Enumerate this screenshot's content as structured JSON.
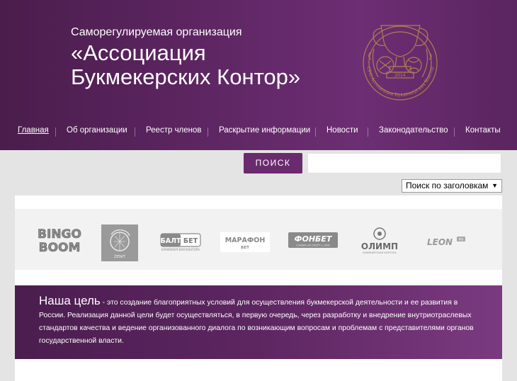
{
  "header": {
    "subtitle": "Саморегулируемая организация",
    "title": "«Ассоциация Букмекерских Контор»",
    "emblem_year": "2014",
    "emblem_ring_text": "СРО Ассоциация Букмекерских Контор"
  },
  "nav": {
    "items": [
      {
        "label": "Главная"
      },
      {
        "label": "Об организации"
      },
      {
        "label": "Реестр членов"
      },
      {
        "label": "Раскрытие информации"
      },
      {
        "label": "Новости"
      },
      {
        "label": "Законодательство"
      },
      {
        "label": "Контакты"
      }
    ]
  },
  "search": {
    "button_label": "ПОИСК",
    "placeholder": "",
    "mode_select": "Поиск по заголовкам"
  },
  "partners": [
    {
      "name": "BINGO BOOM"
    },
    {
      "name": "ZENIT"
    },
    {
      "name": "БАЛТБЕТ"
    },
    {
      "name": "МАРАФОН БЕТ"
    },
    {
      "name": "ФОНБЕТ"
    },
    {
      "name": "ОЛИМП"
    },
    {
      "name": "LEON"
    }
  ],
  "goal": {
    "heading": "Наша цель",
    "text": " - это создание благоприятных условий для осуществления букмекерской деятельности и ее развития в России. Реализация данной цели будет осуществляться, в первую очередь, через разработку и внедрение внутриотраслевых стандартов качества и ведение организованного диалога по возникающим вопросам и проблемам с представителями органов государственной власти."
  },
  "colors": {
    "header_purple": "#5e2663",
    "accent_purple": "#6a2b6e",
    "gold": "#b8864e"
  }
}
